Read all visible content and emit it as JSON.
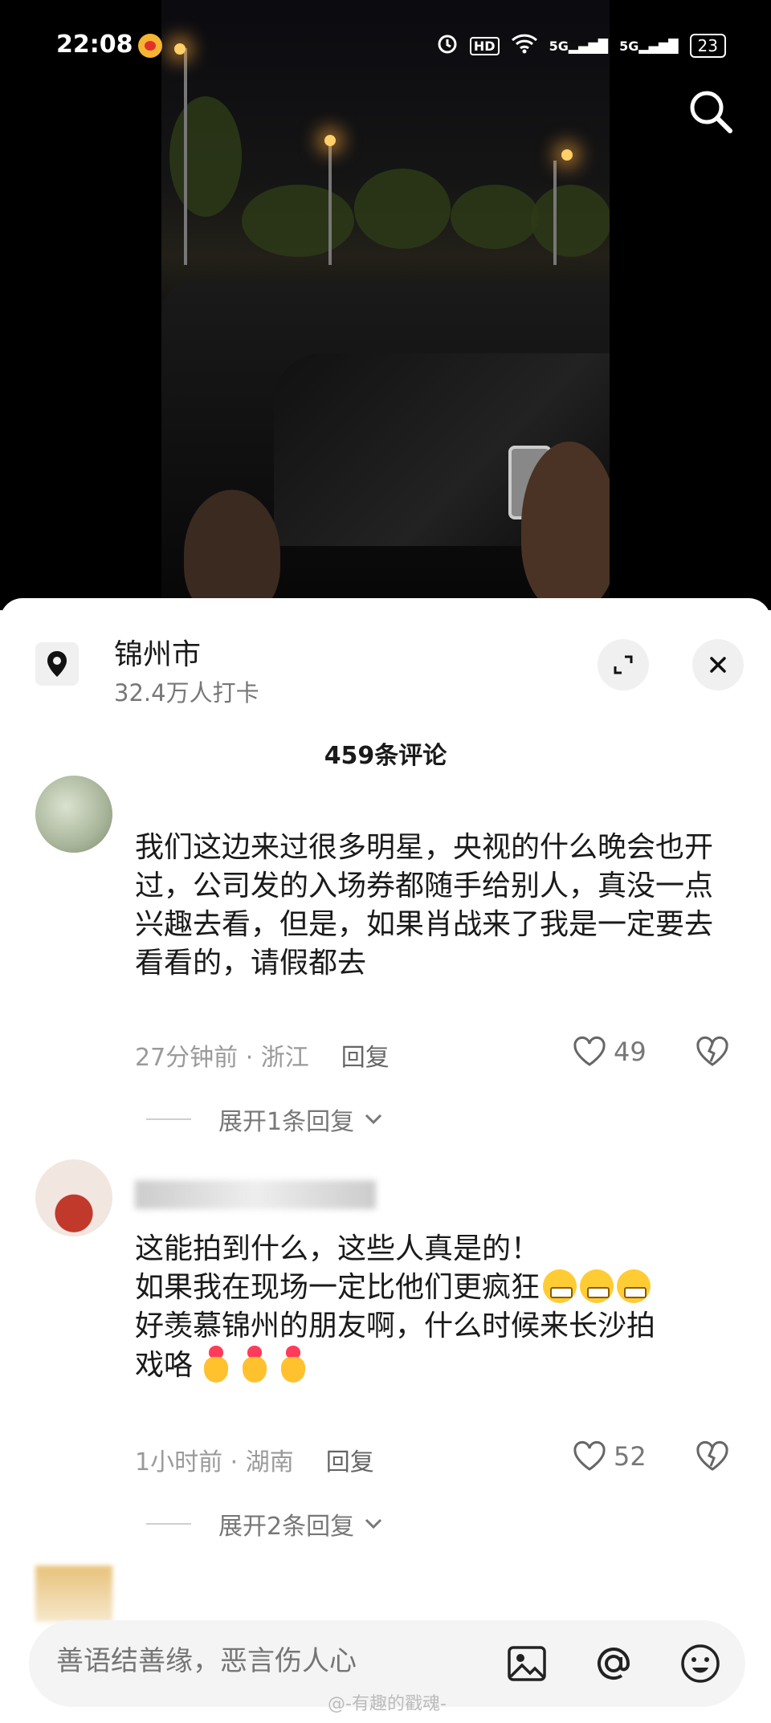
{
  "status_bar": {
    "time": "22:08",
    "network": "5G",
    "network2": "5G",
    "battery": "23",
    "hd": "HD"
  },
  "location": {
    "name": "锦州市",
    "subtitle": "32.4万人打卡"
  },
  "comments_header": "459条评论",
  "comments": [
    {
      "text": "我们这边来过很多明星，央视的什么晚会也开过，公司发的入场券都随手给别人，真没一点兴趣去看，但是，如果肖战来了我是一定要去看看的，请假都去",
      "time": "27分钟前",
      "region": "浙江",
      "reply_label": "回复",
      "likes": "49",
      "expand_label": "展开1条回复"
    },
    {
      "lines": [
        "这能拍到什么，这些人真是的！",
        "如果我在现场一定比他们更疯狂",
        "好羡慕锦州的朋友啊，什么时候来长沙拍",
        "戏咯"
      ],
      "emoji_grin": "grinning-face-icon",
      "emoji_heart_hand": "heart-hands-icon",
      "time": "1小时前",
      "region": "湖南",
      "reply_label": "回复",
      "likes": "52",
      "expand_label": "展开2条回复"
    }
  ],
  "input": {
    "placeholder": "善语结善缘，恶言伤人心"
  },
  "watermark": "@-有趣的戳魂-",
  "colors": {
    "accent_heart": "#ff3b5c",
    "text_primary": "#1a1a1a",
    "text_secondary": "#9a9a9a"
  }
}
